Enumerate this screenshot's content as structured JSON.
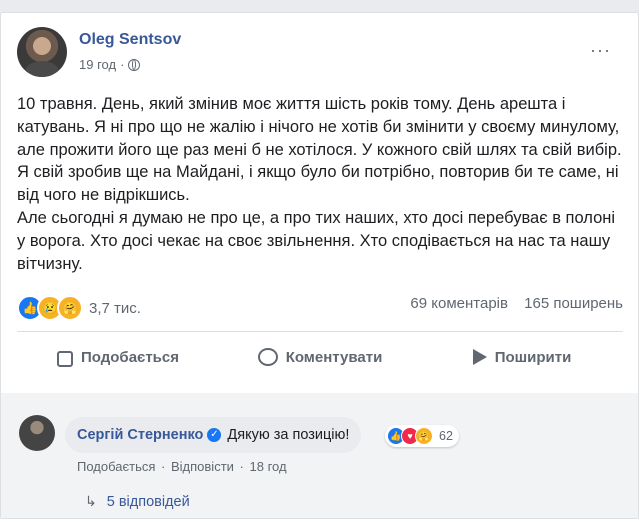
{
  "post": {
    "author": "Oleg Sentsov",
    "time": "19 год",
    "more_glyph": "···",
    "text": "10 травня. День, який змінив моє життя шість років тому. День арешта і катувань. Я ні про що не жалію і нічого не хотів би змінити у своєму минулому, але прожити його ще раз мені б не хотілося. У кожного свій шлях та свій вибір. Я свій зробив ще на Майдані, і якщо було би потрібно, повторив би те саме, ні від чого не відрікшись.\nАле сьогодні я думаю не про це, а про тих наших, хто досі перебуває в полоні у ворога. Хто досі чекає на своє звільнення. Хто сподівається на нас та нашу вітчизну."
  },
  "stats": {
    "reactions": "3,7 тис.",
    "comments": "69 коментарів",
    "shares": "165 поширень"
  },
  "actions": {
    "like": "Подобається",
    "comment": "Коментувати",
    "share": "Поширити"
  },
  "comment": {
    "author": "Сергій Стерненко",
    "text": "Дякую за позицію!",
    "reaction_count": "62",
    "like": "Подобається",
    "reply": "Відповісти",
    "time": "18 год",
    "replies": "5 відповідей"
  },
  "colors": {
    "link": "#385898",
    "like_blue": "#1877f2",
    "muted": "#606770"
  }
}
